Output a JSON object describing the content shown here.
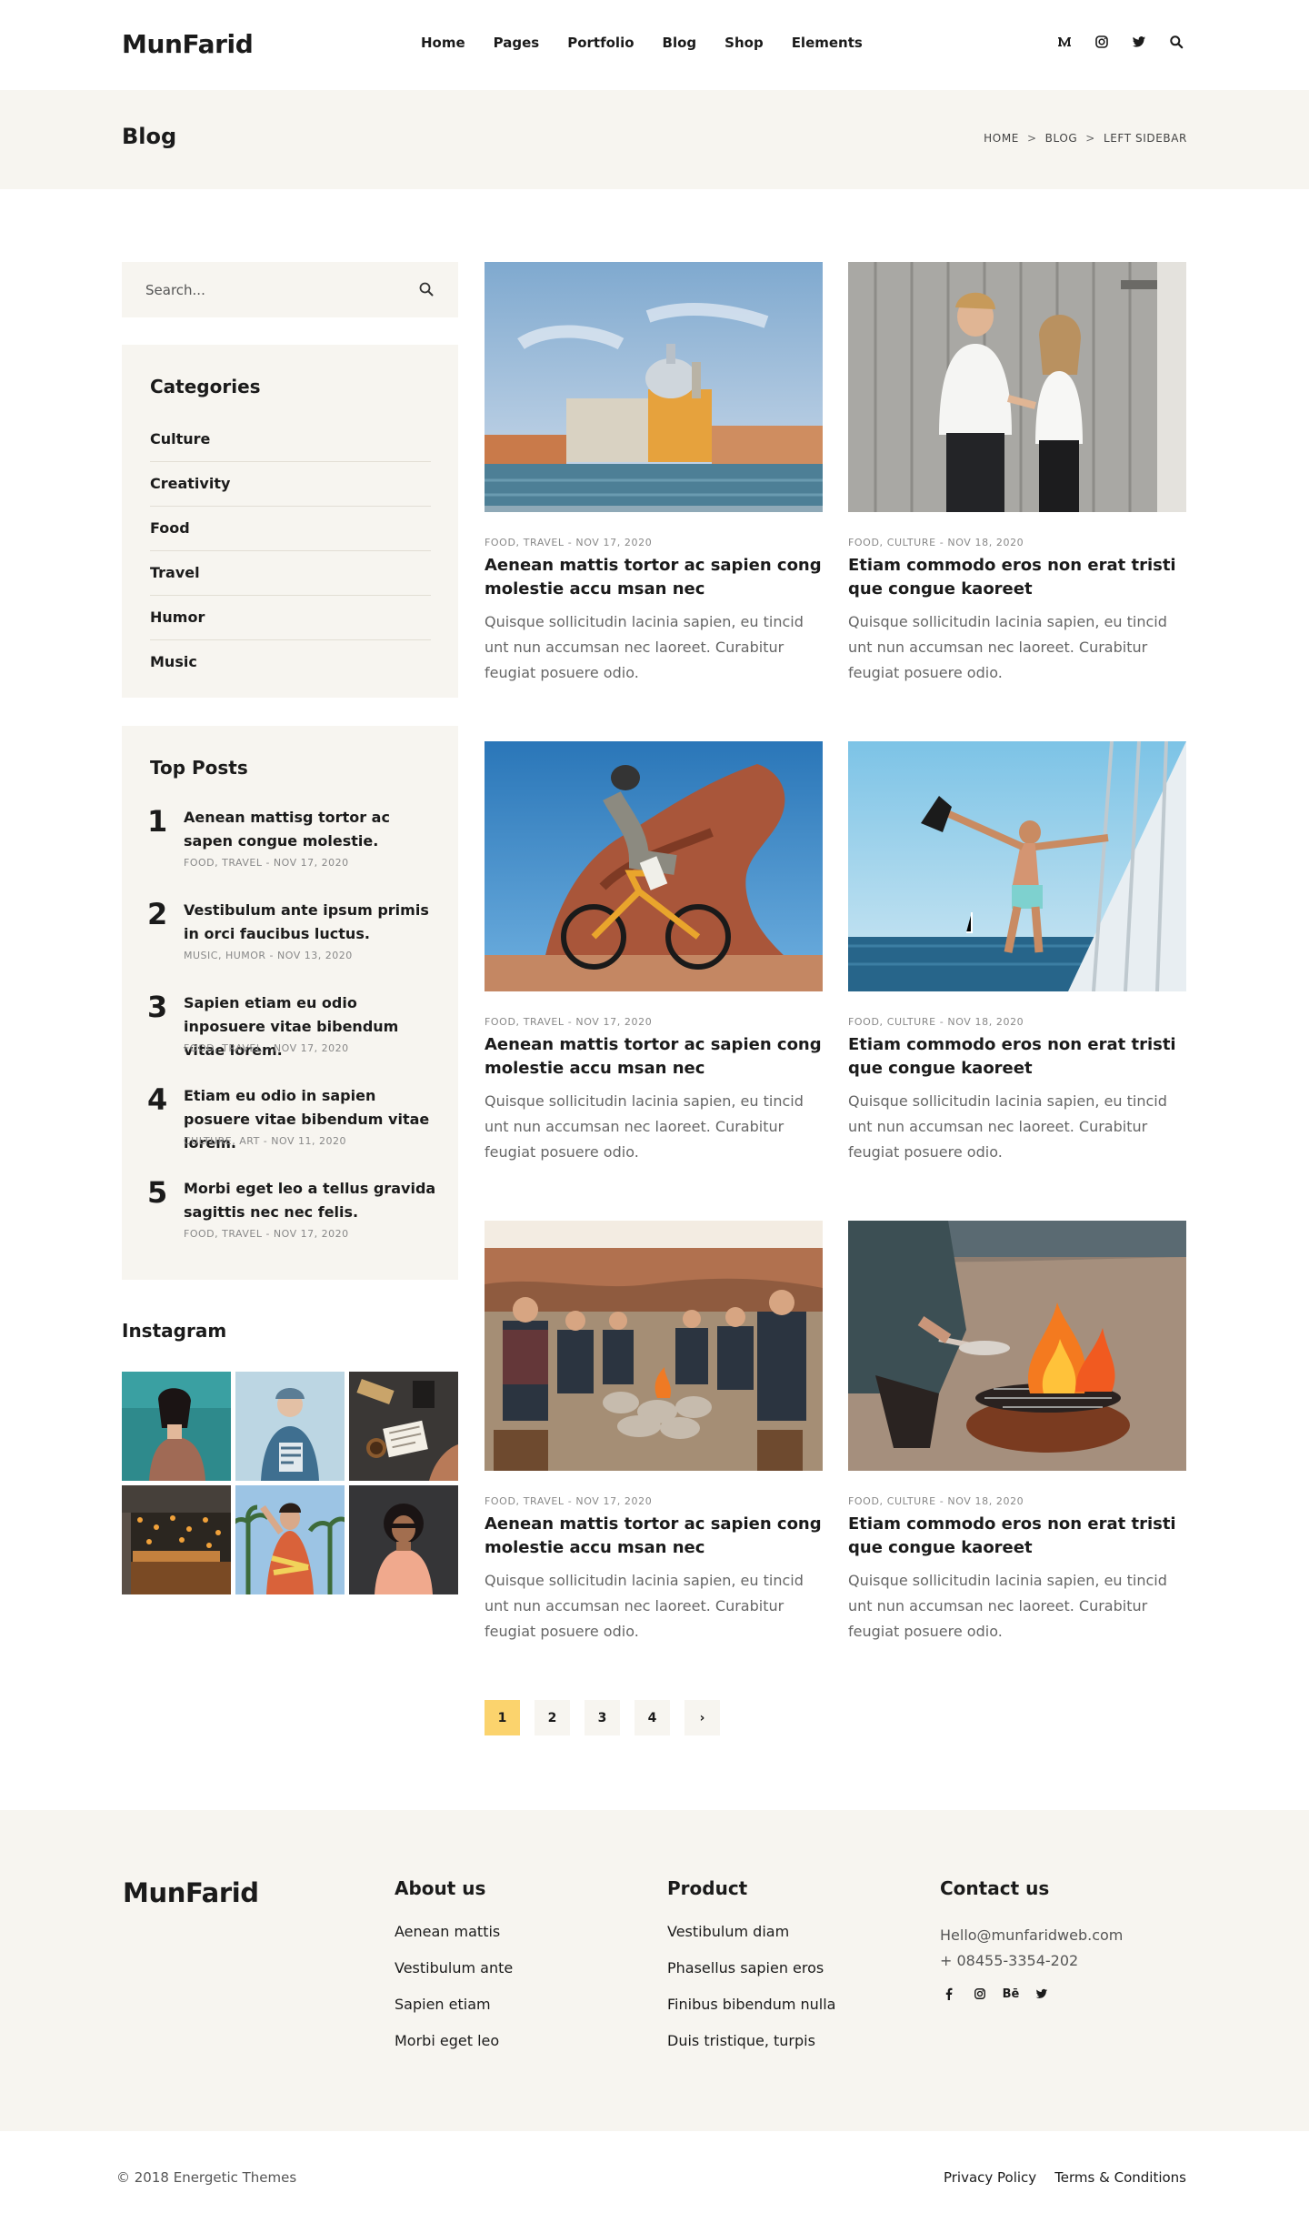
{
  "header": {
    "logo": "MunFarid",
    "nav": [
      "Home",
      "Pages",
      "Portfolio",
      "Blog",
      "Shop",
      "Elements"
    ],
    "icons": [
      "medium-icon",
      "instagram-icon",
      "twitter-icon",
      "search-icon"
    ]
  },
  "titlebar": {
    "title": "Blog",
    "breadcrumb": [
      "HOME",
      "BLOG",
      "LEFT SIDEBAR"
    ]
  },
  "sidebar": {
    "search_placeholder": "Search...",
    "categories_title": "Categories",
    "categories": [
      "Culture",
      "Creativity",
      "Food",
      "Travel",
      "Humor",
      "Music"
    ],
    "top_posts_title": "Top Posts",
    "top_posts": [
      {
        "num": "1",
        "title": "Aenean mattisg tortor ac sapen congue molestie.",
        "meta": "FOOD, TRAVEL - NOV 17, 2020"
      },
      {
        "num": "2",
        "title": "Vestibulum ante ipsum primis in orci faucibus luctus.",
        "meta": "MUSIC, HUMOR - NOV 13, 2020"
      },
      {
        "num": "3",
        "title": "Sapien  etiam eu odio inposuere vitae bibendum vitae lorem.",
        "meta": "FOOD, TRAVEL - NOV 17, 2020"
      },
      {
        "num": "4",
        "title": "Etiam eu odio in sapien posuere vitae bibendum vitae lorem.",
        "meta": "CULTURE, ART - NOV 11, 2020"
      },
      {
        "num": "5",
        "title": "Morbi eget leo a tellus gravida sagittis nec nec felis.",
        "meta": "FOOD, TRAVEL - NOV 17, 2020"
      }
    ],
    "instagram_title": "Instagram"
  },
  "posts": [
    {
      "meta": "FOOD, TRAVEL - NOV 17, 2020",
      "title": "Aenean mattis tortor ac sapien cong molestie accu msan nec",
      "excerpt": "Quisque sollicitudin lacinia sapien, eu tincid unt nun accumsan nec laoreet. Curabitur feugiat posuere odio."
    },
    {
      "meta": "FOOD, CULTURE - NOV 18, 2020",
      "title": "Etiam commodo eros non erat tristi que congue kaoreet",
      "excerpt": "Quisque sollicitudin lacinia sapien, eu tincid unt nun accumsan nec laoreet. Curabitur feugiat posuere odio."
    },
    {
      "meta": "FOOD, TRAVEL - NOV 17, 2020",
      "title": "Aenean mattis tortor ac sapien cong molestie accu msan nec",
      "excerpt": "Quisque sollicitudin lacinia sapien, eu tincid unt nun accumsan nec laoreet. Curabitur feugiat posuere odio."
    },
    {
      "meta": "FOOD, CULTURE - NOV 18, 2020",
      "title": "Etiam commodo eros non erat tristi que congue kaoreet",
      "excerpt": "Quisque sollicitudin lacinia sapien, eu tincid unt nun accumsan nec laoreet. Curabitur feugiat posuere odio."
    },
    {
      "meta": "FOOD, TRAVEL - NOV 17, 2020",
      "title": "Aenean mattis tortor ac sapien cong molestie accu msan nec",
      "excerpt": "Quisque sollicitudin lacinia sapien, eu tincid unt nun accumsan nec laoreet. Curabitur feugiat posuere odio."
    },
    {
      "meta": "FOOD, CULTURE - NOV 18, 2020",
      "title": "Etiam commodo eros non erat tristi que congue kaoreet",
      "excerpt": "Quisque sollicitudin lacinia sapien, eu tincid unt nun accumsan nec laoreet. Curabitur feugiat posuere odio."
    }
  ],
  "pagination": {
    "pages": [
      "1",
      "2",
      "3",
      "4"
    ],
    "next": "›",
    "active": "1"
  },
  "footer": {
    "logo": "MunFarid",
    "about_title": "About us",
    "about_links": [
      "Aenean mattis",
      "Vestibulum ante",
      "Sapien etiam",
      "Morbi eget leo"
    ],
    "product_title": "Product",
    "product_links": [
      "Vestibulum diam",
      "Phasellus sapien eros",
      "Finibus bibendum nulla",
      "Duis tristique, turpis"
    ],
    "contact_title": "Contact us",
    "email": "Hello@munfaridweb.com",
    "phone": "+ 08455-3354-202",
    "social": [
      "facebook-icon",
      "instagram-icon",
      "behance-icon",
      "twitter-icon"
    ],
    "behance_label": "Bē",
    "copyright": "© 2018 Energetic Themes",
    "bottom_links": [
      "Privacy Policy",
      "Terms & Conditions"
    ]
  },
  "colors": {
    "accent": "#fbd36d",
    "panel": "#f7f5f0",
    "text": "#1b1b1b",
    "muted": "#666666"
  }
}
